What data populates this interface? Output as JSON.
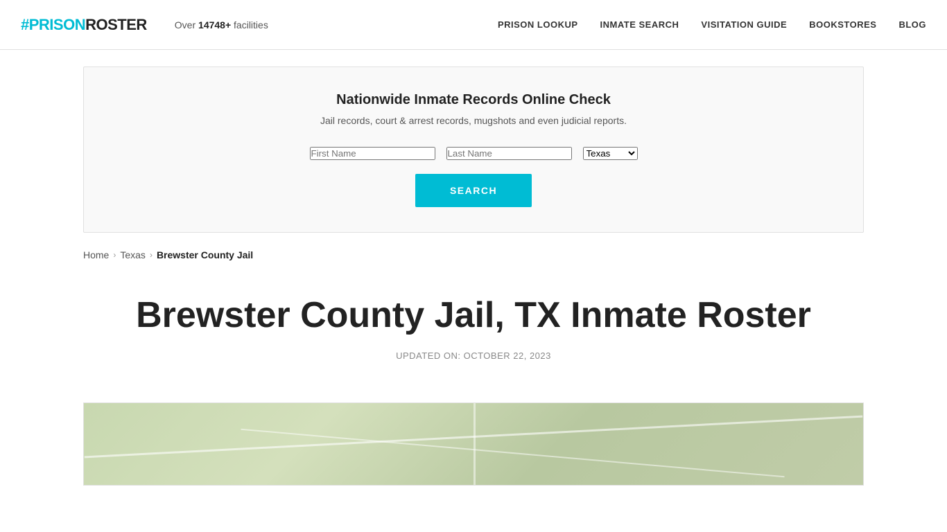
{
  "header": {
    "logo_hash": "#",
    "logo_prison": "PRISON",
    "logo_roster": "ROSTER",
    "facilities_text": "Over ",
    "facilities_count": "14748+",
    "facilities_suffix": " facilities",
    "nav": {
      "prison_lookup": "PRISON LOOKUP",
      "inmate_search": "INMATE SEARCH",
      "visitation_guide": "VISITATION GUIDE",
      "bookstores": "BOOKSTORES",
      "blog": "BLOG"
    }
  },
  "search_section": {
    "title": "Nationwide Inmate Records Online Check",
    "subtitle": "Jail records, court & arrest records, mugshots and even judicial reports.",
    "first_name_placeholder": "First Name",
    "last_name_placeholder": "Last Name",
    "state_selected": "Texas",
    "search_button": "SEARCH"
  },
  "breadcrumb": {
    "home": "Home",
    "state": "Texas",
    "current": "Brewster County Jail"
  },
  "main": {
    "page_title": "Brewster County Jail, TX Inmate Roster",
    "updated_label": "UPDATED ON: OCTOBER 22, 2023"
  }
}
